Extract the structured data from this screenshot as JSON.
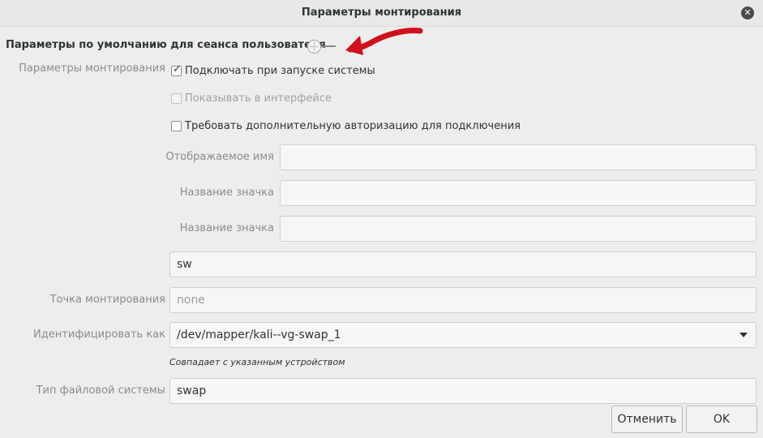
{
  "window": {
    "title": "Параметры монтирования",
    "close_glyph": "✕"
  },
  "session": {
    "title": "Параметры по умолчанию для сеанса пользователя",
    "toggle_on": false
  },
  "mount_options": {
    "label": "Параметры монтирования",
    "startup": {
      "label": "Подключать при запуске системы",
      "checked": true
    },
    "show_ui": {
      "label": "Показывать в интерфейсе",
      "checked": false,
      "disabled": true
    },
    "require_auth": {
      "label": "Требовать дополнительную авторизацию для подключения",
      "checked": false
    }
  },
  "display_name": {
    "label": "Отображаемое имя",
    "value": ""
  },
  "icon_name": {
    "label": "Название значка",
    "value": ""
  },
  "icon_name_2": {
    "label": "Название значка",
    "value": ""
  },
  "options_field": {
    "value": "sw"
  },
  "mount_point": {
    "label": "Точка монтирования",
    "placeholder": "none"
  },
  "identify_as": {
    "label": "Идентифицировать как",
    "value": "/dev/mapper/kali--vg-swap_1",
    "hint": "Совпадает с указанным устройством"
  },
  "fs_type": {
    "label": "Тип файловой системы",
    "value": "swap"
  },
  "buttons": {
    "cancel": "Отменить",
    "ok": "OK"
  },
  "colors": {
    "annotation": "#d10f1c",
    "background": "#ededed"
  }
}
